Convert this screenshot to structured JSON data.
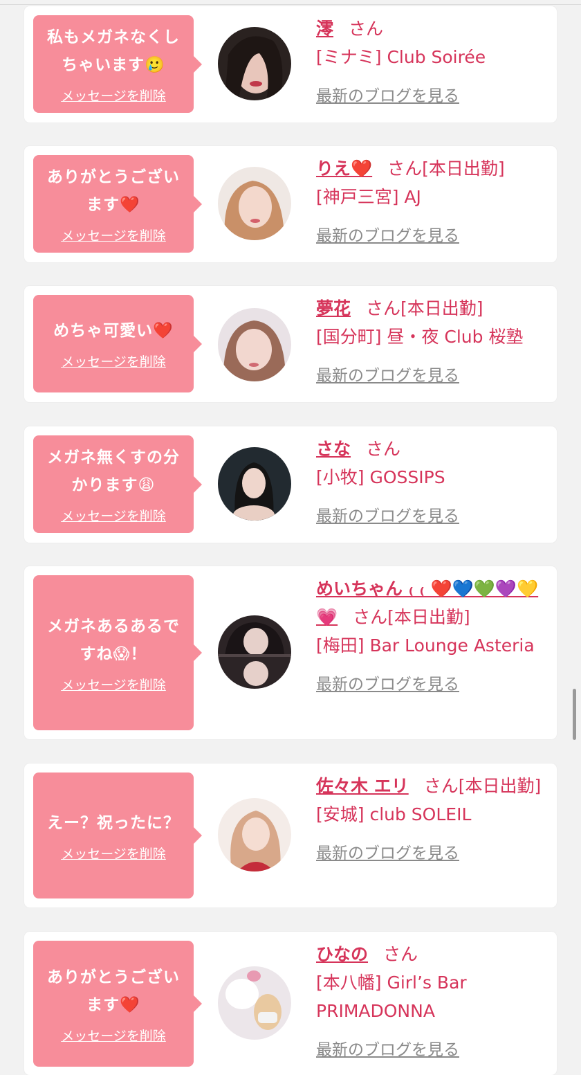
{
  "delete_label": "メッセージを削除",
  "blog_label": "最新のブログを見る",
  "san_label": "さん",
  "cards": [
    {
      "message": "私もメガネなくしちゃいます🥲",
      "name": "澪",
      "status": "",
      "shop": "[ミナミ] Club Soirée"
    },
    {
      "message": "ありがとうございます❤️",
      "name": "りえ❤️",
      "status": "[本日出勤]",
      "shop": "[神戸三宮] AJ"
    },
    {
      "message": "めちゃ可愛い❤️",
      "name": "夢花",
      "status": "[本日出勤]",
      "shop": "[国分町] 昼・夜 Club 桜塾"
    },
    {
      "message": "メガネ無くすの分かります😩",
      "name": "さな",
      "status": "",
      "shop": "[小牧] GOSSIPS"
    },
    {
      "message": "メガネあるあるですね😱！",
      "name": "めいちゃん ₍ ₍ ❤️💙💚💜💛💗",
      "status": "[本日出勤]",
      "shop": "[梅田] Bar Lounge Asteria"
    },
    {
      "message": "えー？祝ったに？",
      "name": "佐々木 エリ",
      "status": "[本日出勤]",
      "shop": "[安城] club SOLEIL"
    },
    {
      "message": "ありがとうございます❤️",
      "name": "ひなの",
      "status": "",
      "shop": "[本八幡] Girl’s Bar PRIMADONNA"
    }
  ],
  "colors": {
    "bubble": "#f78d9a",
    "name_text": "#d6345a",
    "link_gray": "#8a8a8a",
    "background": "#f2f2f2"
  }
}
